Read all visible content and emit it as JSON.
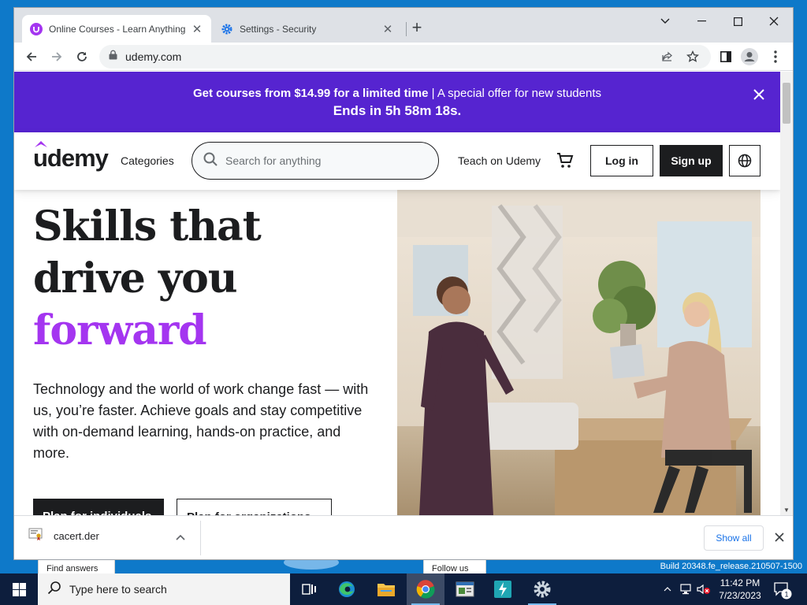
{
  "browser": {
    "tabs": [
      {
        "title": "Online Courses - Learn Anything",
        "active": true
      },
      {
        "title": "Settings - Security",
        "active": false
      }
    ],
    "url": "udemy.com"
  },
  "promo": {
    "bold": "Get courses from $14.99 for a limited time",
    "separator": " | ",
    "rest": "A special offer for new students",
    "countdown": "Ends in 5h 58m 18s."
  },
  "header": {
    "logo": "udemy",
    "categories": "Categories",
    "search_placeholder": "Search for anything",
    "teach": "Teach on Udemy",
    "login": "Log in",
    "signup": "Sign up"
  },
  "hero": {
    "headline_line1": "Skills that",
    "headline_line2": "drive you",
    "headline_accent": "forward",
    "description": "Technology and the world of work change fast — with us, you’re faster. Achieve goals and stay competitive with on-demand learning, hands-on practice, and more.",
    "cta_individuals": "Plan for individuals",
    "cta_organizations": "Plan for organizations"
  },
  "downloads": {
    "file_name": "cacert.der",
    "show_all": "Show all"
  },
  "desktop": {
    "card_left": "Find answers",
    "card_right": "Follow us",
    "build": "Build 20348.fe_release.210507-1500"
  },
  "taskbar": {
    "search_placeholder": "Type here to search",
    "time": "11:42 PM",
    "date": "7/23/2023",
    "notification_count": "1"
  },
  "colors": {
    "promo_bg": "#5624d0",
    "accent_purple": "#a435f0",
    "dark": "#1c1d1f",
    "link_blue": "#1a73e8"
  }
}
